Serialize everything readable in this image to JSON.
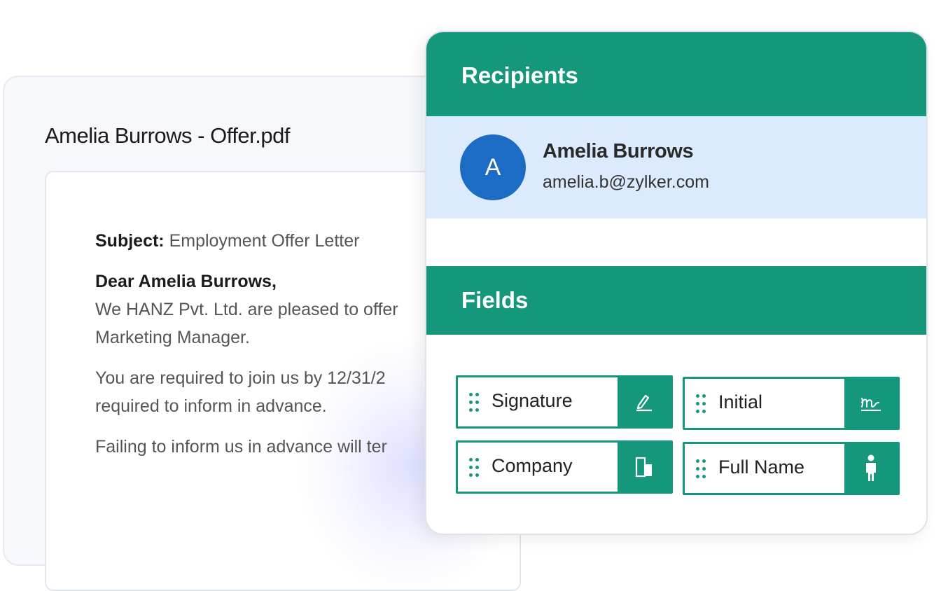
{
  "document": {
    "title": "Amelia Burrows - Offer.pdf",
    "subject_label": "Subject:",
    "subject_value": " Employment Offer Letter",
    "greeting": "Dear Amelia Burrows,",
    "line1": "We HANZ Pvt. Ltd. are pleased to offer",
    "line2": "Marketing Manager.",
    "line3": "You are required to join us by 12/31/2",
    "line4": "required to inform in advance.",
    "line5": "Failing to inform us in advance will ter"
  },
  "panel": {
    "recipients_header": "Recipients",
    "recipient": {
      "avatar_initial": "A",
      "name": "Amelia Burrows",
      "email": "amelia.b@zylker.com"
    },
    "fields_header": "Fields",
    "fields": [
      {
        "label": "Signature",
        "icon": "signature-pen-icon"
      },
      {
        "label": "Initial",
        "icon": "initial-script-icon"
      },
      {
        "label": "Company",
        "icon": "building-icon"
      },
      {
        "label": "Full Name",
        "icon": "person-icon"
      }
    ]
  },
  "colors": {
    "accent": "#14977b",
    "recipient_row": "#dbeafd",
    "avatar": "#1c6bc4"
  }
}
